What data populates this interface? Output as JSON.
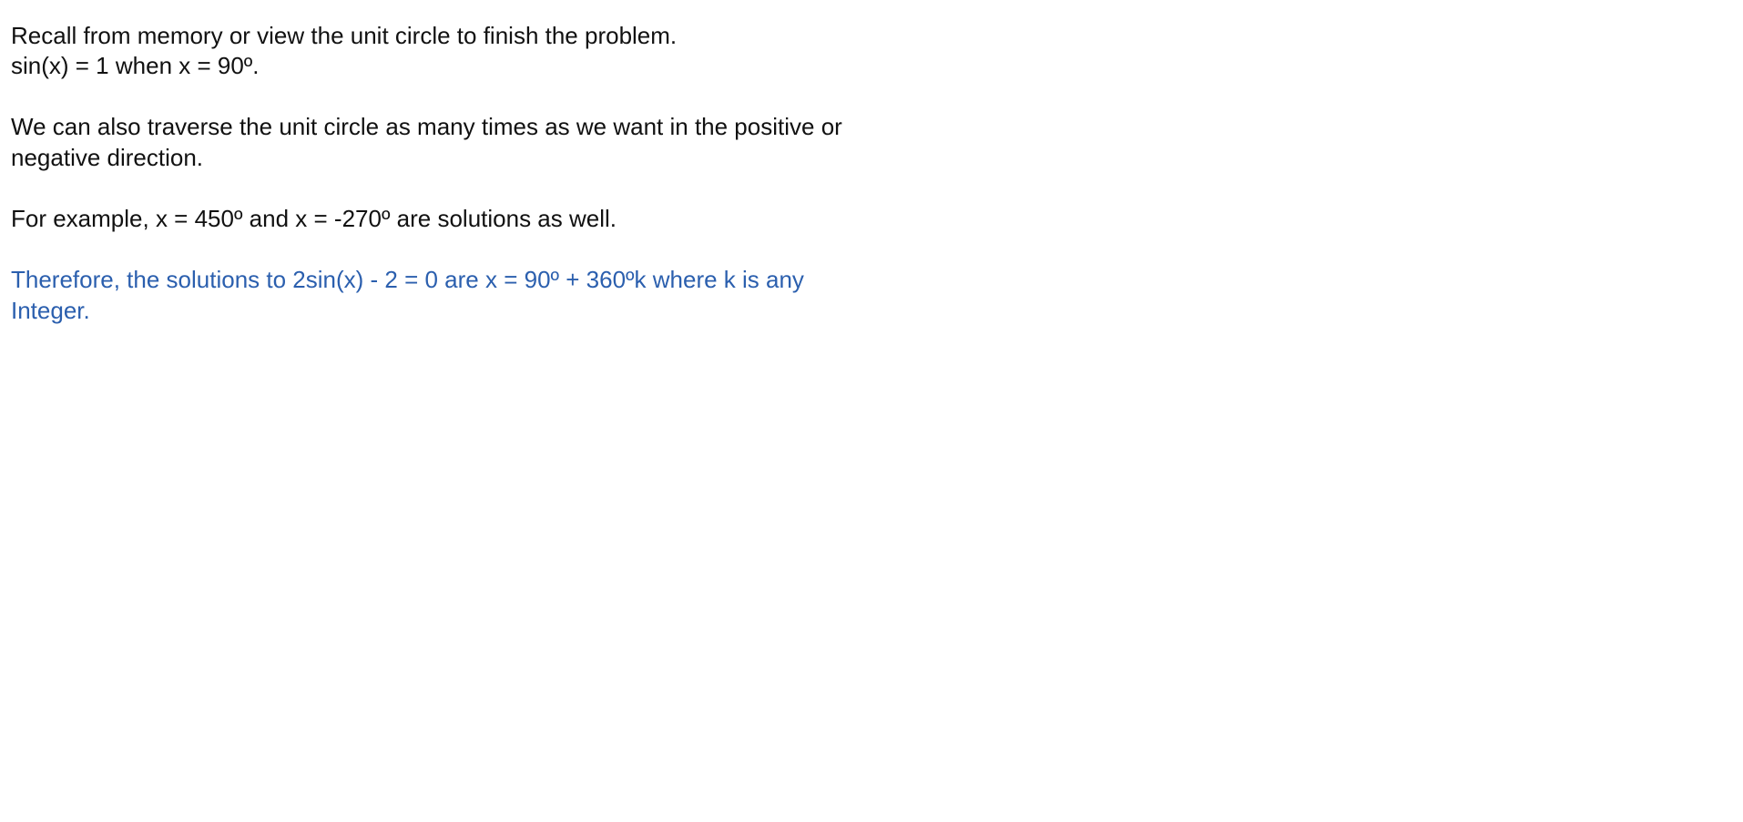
{
  "document": {
    "paragraph1": {
      "line1": "Recall from memory or view the unit circle to finish the problem.",
      "line2": "sin(x) = 1 when x = 90º."
    },
    "paragraph2": {
      "line1": "We can also traverse the unit circle as many times as we want in the positive or",
      "line2": "negative direction."
    },
    "paragraph3": {
      "line1": "For example, x = 450º and x = -270º are solutions as well."
    },
    "conclusion": {
      "line1": "Therefore, the solutions to 2sin(x) - 2 = 0 are x = 90º + 360ºk  where k is any",
      "line2": "Integer.",
      "color": "#2b5fae"
    }
  }
}
